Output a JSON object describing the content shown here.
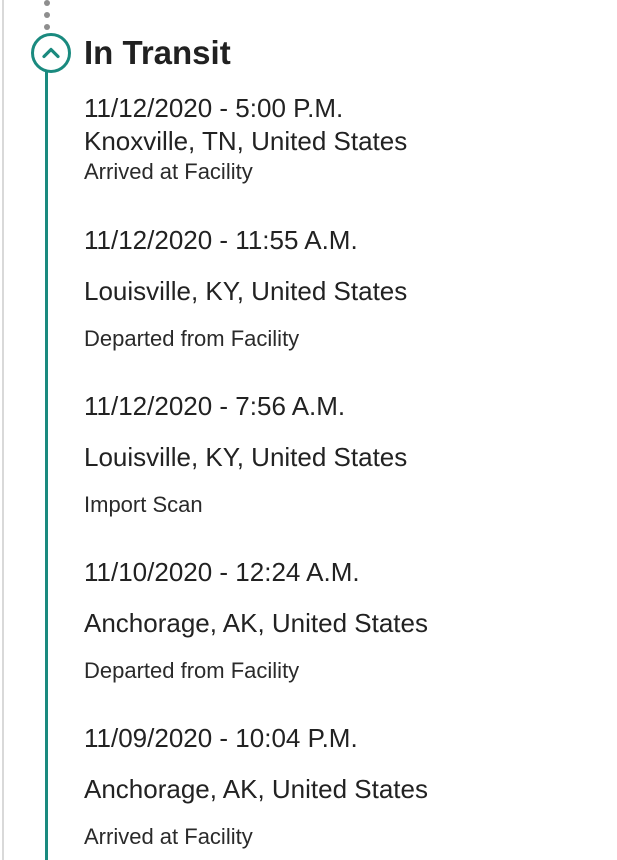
{
  "colors": {
    "accent": "#1a8a7f",
    "text": "#212121",
    "dots": "#8e8e8e",
    "border": "#d9d9d9"
  },
  "status": {
    "title": "In Transit",
    "toggle_icon": "chevron-up-icon"
  },
  "events": [
    {
      "datetime": "11/12/2020 - 5:00 P.M.",
      "location": "Knoxville, TN, United States",
      "description": "Arrived at Facility"
    },
    {
      "datetime": "11/12/2020 - 11:55 A.M.",
      "location": "Louisville, KY, United States",
      "description": "Departed from Facility"
    },
    {
      "datetime": "11/12/2020 - 7:56 A.M.",
      "location": "Louisville, KY, United States",
      "description": "Import Scan"
    },
    {
      "datetime": "11/10/2020 - 12:24 A.M.",
      "location": "Anchorage, AK, United States",
      "description": "Departed from Facility"
    },
    {
      "datetime": "11/09/2020 - 10:04 P.M.",
      "location": "Anchorage, AK, United States",
      "description": "Arrived at Facility"
    }
  ]
}
